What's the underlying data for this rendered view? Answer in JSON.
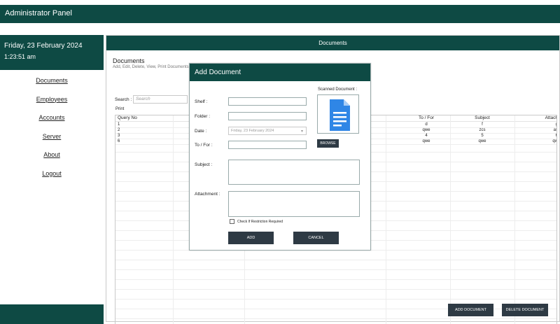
{
  "app": {
    "title": "Administrator Panel"
  },
  "sidebar": {
    "date": "Friday, 23 February 2024",
    "time": "1:23:51 am",
    "items": [
      {
        "label": "Documents"
      },
      {
        "label": "Employees"
      },
      {
        "label": "Accounts"
      },
      {
        "label": "Server"
      },
      {
        "label": "About"
      },
      {
        "label": "Logout"
      }
    ]
  },
  "main": {
    "header": "Documents",
    "title": "Documents",
    "subtitle": "Add, Edit, Delete, View, Print Documents",
    "search": {
      "label": "Search :",
      "placeholder": "Search"
    },
    "print_label": "Print",
    "table": {
      "columns": [
        "Query No",
        "To / For",
        "Subject",
        "Attach"
      ],
      "rows": [
        [
          "1",
          "d",
          "f",
          "g"
        ],
        [
          "2",
          "qwe",
          "zcs",
          "as"
        ],
        [
          "3",
          "4",
          "5",
          "6"
        ],
        [
          "6",
          "qwe",
          "qwe",
          "qw"
        ]
      ]
    },
    "add_document": "ADD DOCUMENT",
    "delete_document": "DELETE DOCUMENT"
  },
  "modal": {
    "title": "Add Document",
    "fields": {
      "shelf": "Shelf :",
      "folder": "Folder :",
      "date": "Date :",
      "to_for": "To / For :",
      "subject": "Subject :",
      "attachment": "Attachment :"
    },
    "date_value": "Friday, 23 February 2024",
    "scanned_label": "Scanned Document :",
    "browse": "BROWSE",
    "checkbox_label": "Check If Restriction Required",
    "add": "ADD",
    "cancel": "CANCEL"
  },
  "colors": {
    "primary": "#0e4a44",
    "button": "#2e3a44",
    "doc_icon": "#2f86e6"
  }
}
